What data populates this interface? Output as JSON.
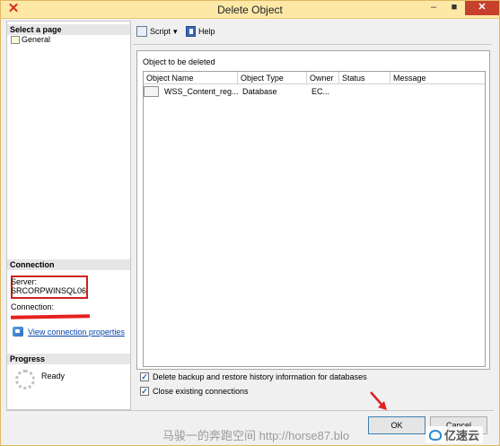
{
  "window": {
    "title": "Delete Object",
    "minimize": "–",
    "maximize": "■",
    "close": "✕"
  },
  "left": {
    "select_page_header": "Select a page",
    "pages": [
      {
        "label": "General"
      }
    ],
    "connection_header": "Connection",
    "server_label": "Server:",
    "server_value": "SRCORPWINSQL06",
    "connection_label": "Connection:",
    "view_connection_link": "View connection properties",
    "progress_header": "Progress",
    "progress_status": "Ready"
  },
  "toolbar": {
    "script_label": "Script",
    "dropdown": "▾",
    "help_label": "Help"
  },
  "main": {
    "objects_label": "Object to be deleted",
    "columns": [
      "Object Name",
      "Object Type",
      "Owner",
      "Status",
      "Message"
    ],
    "rows": [
      {
        "name": "WSS_Content_reg...",
        "type": "Database",
        "owner": "EC...",
        "status": "",
        "message": ""
      }
    ]
  },
  "options": {
    "delete_backup_label": "Delete backup and restore history information for databases",
    "delete_backup_checked": true,
    "close_connections_label": "Close existing connections",
    "close_connections_checked": true
  },
  "buttons": {
    "ok": "OK",
    "cancel": "Cancel"
  },
  "watermark": {
    "text": "马骏一的奔跑空间 http://horse87.blo",
    "logo_text": "亿速云"
  },
  "colors": {
    "titlebar": "#fde8a8",
    "close_button": "#c7402e",
    "highlight_box": "#d02020",
    "link": "#0645ad"
  }
}
